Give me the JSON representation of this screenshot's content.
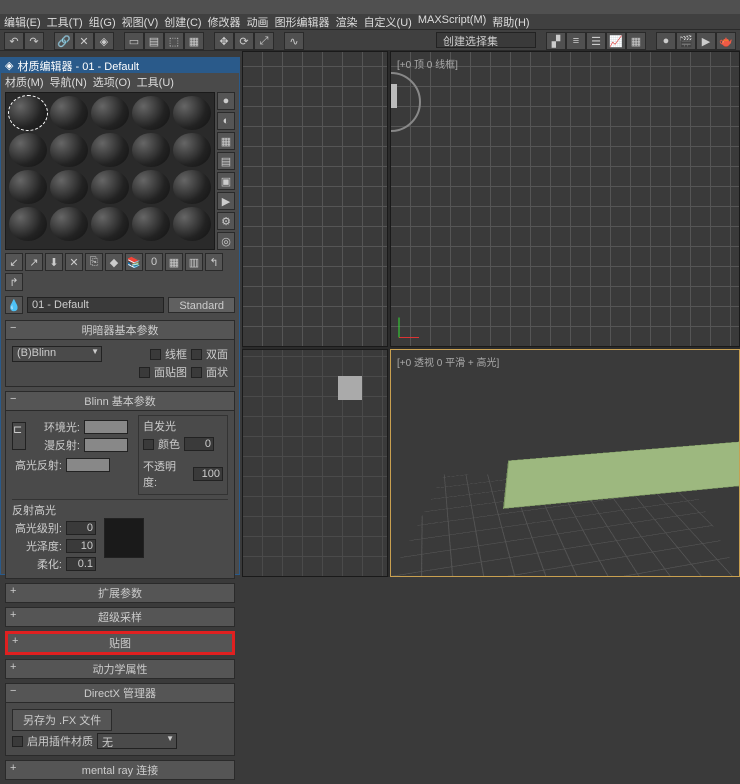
{
  "menus": {
    "edit": "编辑(E)",
    "tools": "工具(T)",
    "group": "组(G)",
    "views": "视图(V)",
    "create": "创建(C)",
    "modifiers": "修改器",
    "animation": "动画",
    "graph": "图形编辑器",
    "render": "渲染",
    "custom": "自定义(U)",
    "maxscript": "MAXScript(M)",
    "help": "帮助(H)"
  },
  "toolbar": {
    "selector_prompt": "创建选择集"
  },
  "viewports": {
    "top_right_label": "[+0 顶 0 线框]",
    "persp_label": "[+0 透视 0 平滑 + 高光]"
  },
  "mat_editor": {
    "title": "材质编辑器 - 01 - Default",
    "menus": {
      "material": "材质(M)",
      "navigate": "导航(N)",
      "options": "选项(O)",
      "tools": "工具(U)"
    },
    "name": "01 - Default",
    "type_btn": "Standard",
    "rollouts": {
      "shader_basic": "明暗器基本参数",
      "blinn_basic": "Blinn 基本参数",
      "extended": "扩展参数",
      "supersample": "超级采样",
      "maps": "贴图",
      "dynamics": "动力学属性",
      "directx": "DirectX 管理器",
      "mentalray": "mental ray 连接"
    },
    "shader": {
      "type": "(B)Blinn",
      "wire": "线框",
      "two_sided": "双面",
      "face_map": "面贴图",
      "faceted": "面状"
    },
    "blinn": {
      "ambient": "环境光:",
      "diffuse": "漫反射:",
      "specular": "高光反射:",
      "self_illum": "自发光",
      "color_cb": "颜色",
      "self_val": "0",
      "opacity": "不透明度:",
      "opacity_val": "100",
      "spec_hl": "反射高光",
      "spec_level": "高光级别:",
      "spec_level_val": "0",
      "gloss": "光泽度:",
      "gloss_val": "10",
      "soften": "柔化:",
      "soften_val": "0.1"
    },
    "directx_body": {
      "save_fx": "另存为 .FX 文件",
      "enable": "启用插件材质",
      "none": "无"
    }
  }
}
